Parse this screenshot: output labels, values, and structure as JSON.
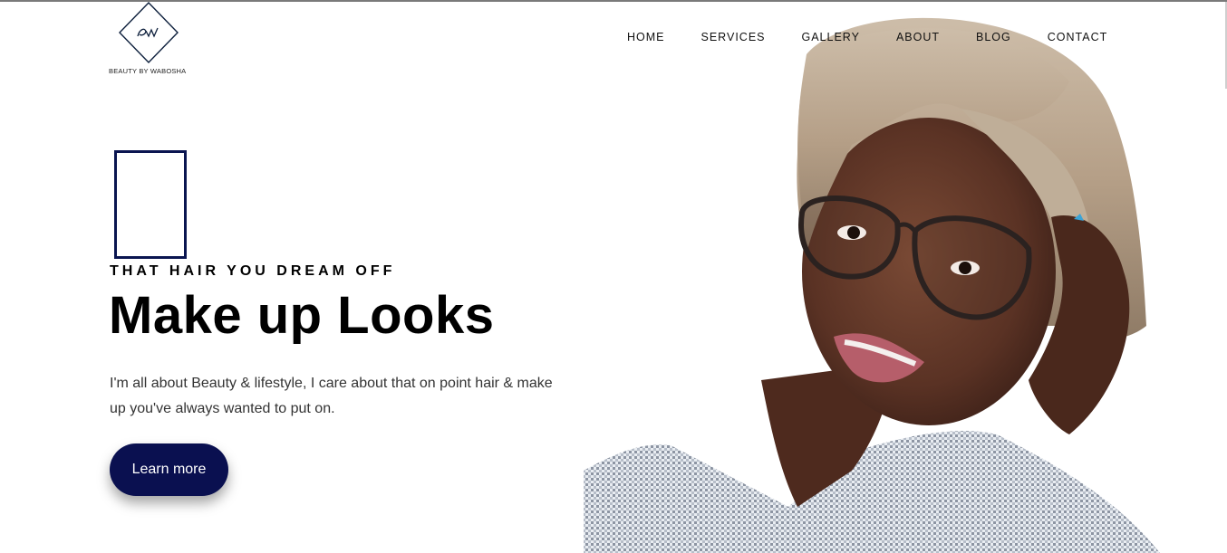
{
  "brand": {
    "logo_monogram": "BW",
    "name": "BEAUTY BY WABOSHA",
    "accent_color": "#0a1050"
  },
  "nav": {
    "items": [
      {
        "label": "HOME"
      },
      {
        "label": "SERVICES"
      },
      {
        "label": "GALLERY"
      },
      {
        "label": "ABOUT"
      },
      {
        "label": "BLOG"
      },
      {
        "label": "CONTACT"
      }
    ]
  },
  "hero": {
    "eyebrow": "THAT HAIR YOU DREAM OFF",
    "headline": "Make up Looks",
    "body": "I'm all about Beauty & lifestyle, I care about that on point hair & make up you've always wanted to put on.",
    "cta_label": "Learn more"
  }
}
